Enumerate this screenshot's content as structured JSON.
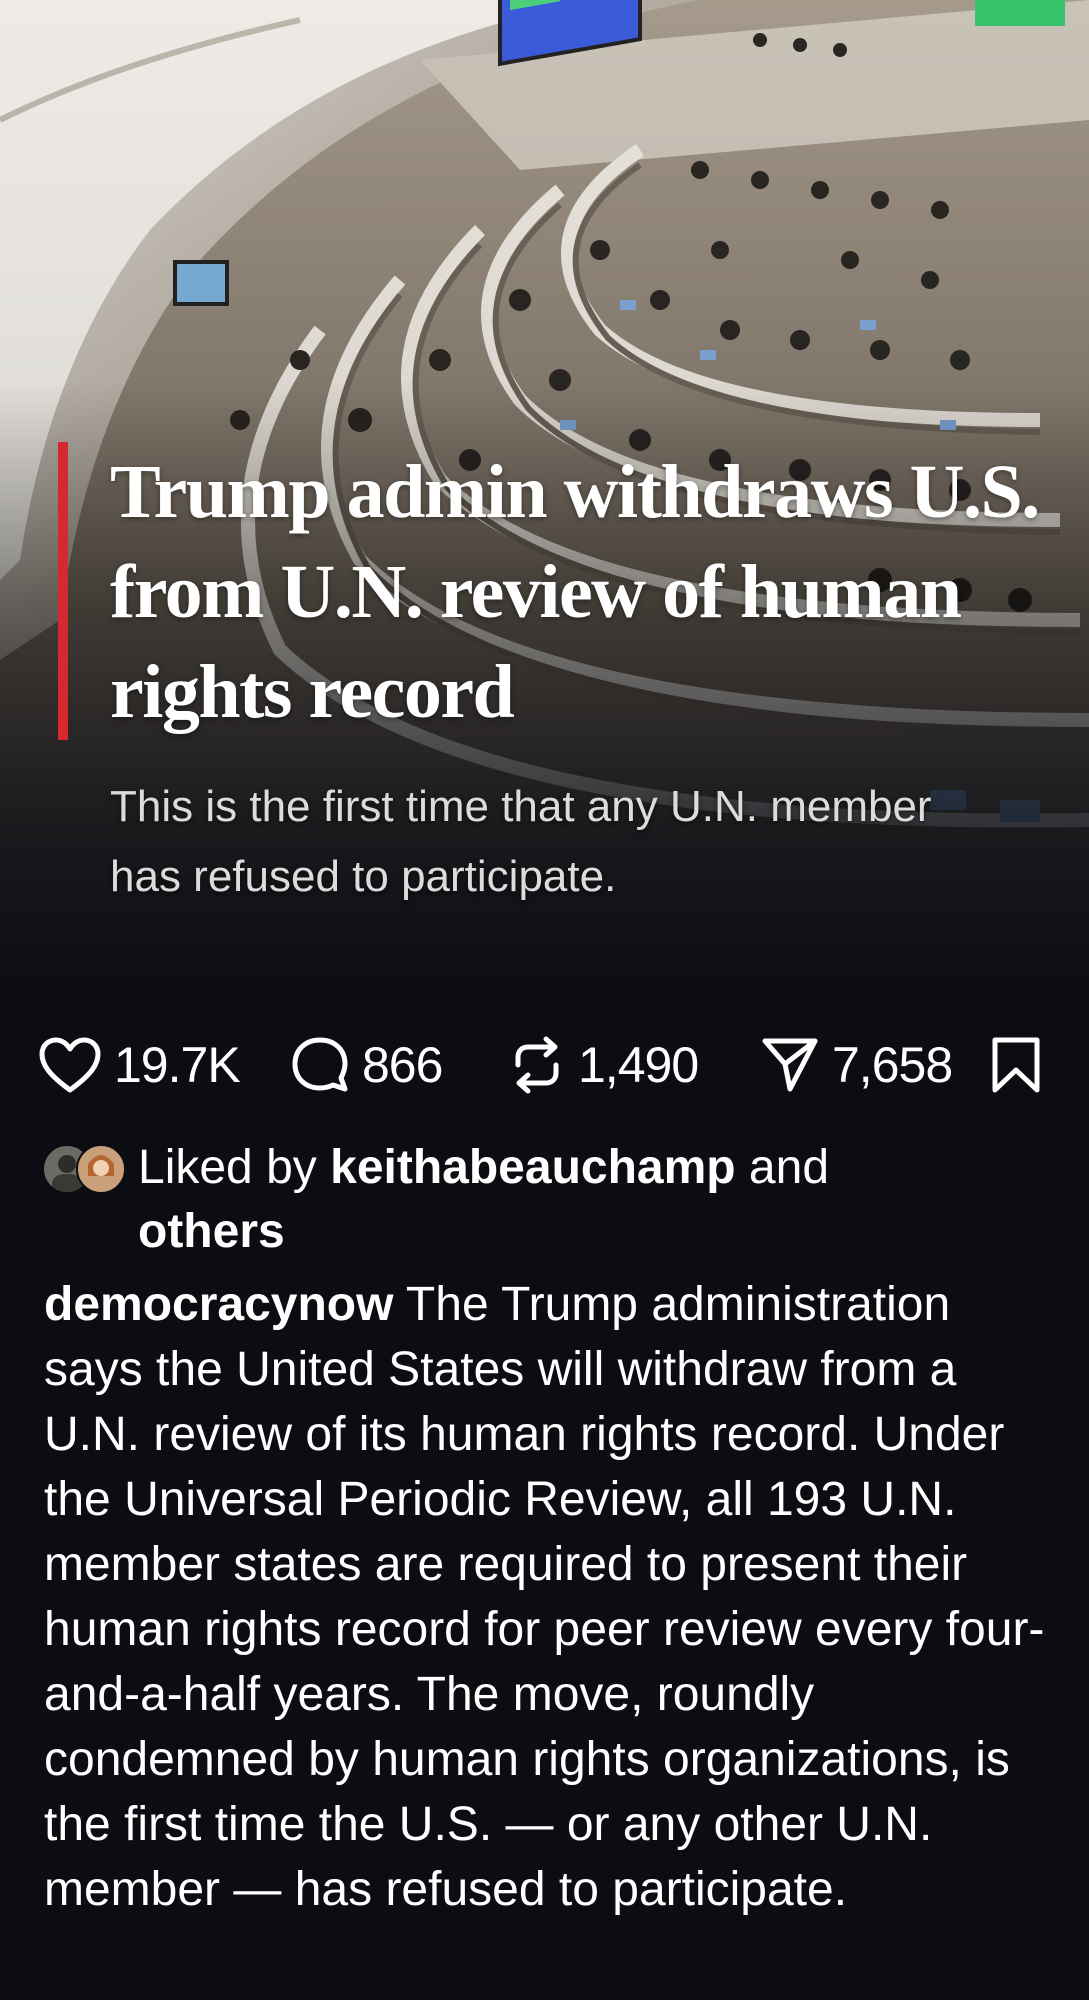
{
  "post": {
    "headline": "Trump admin withdraws U.S. from U.N. review of human rights record",
    "subheadline": "This is the first time that any U.N. member has refused to participate.",
    "accent_color": "#d7282f"
  },
  "actions": {
    "likes": "19.7K",
    "comments": "866",
    "reposts": "1,490",
    "shares": "7,658",
    "icons": [
      "heart-icon",
      "comment-icon",
      "repost-icon",
      "share-icon",
      "bookmark-icon"
    ]
  },
  "liked_by": {
    "prefix": "Liked by ",
    "user": "keithabeauchamp",
    "middle": " and ",
    "others": "others"
  },
  "caption": {
    "username": "democracynow",
    "text": " The Trump administration says the United States will withdraw from a U.N. review of its human rights record. Under the Universal Periodic Review, all 193 U.N. member states are required to present their human rights record for peer review every four-and-a-half years. The move, roundly condemned by human rights organizations, is the first time the U.S. — or any other U.N. member — has refused to participate."
  }
}
